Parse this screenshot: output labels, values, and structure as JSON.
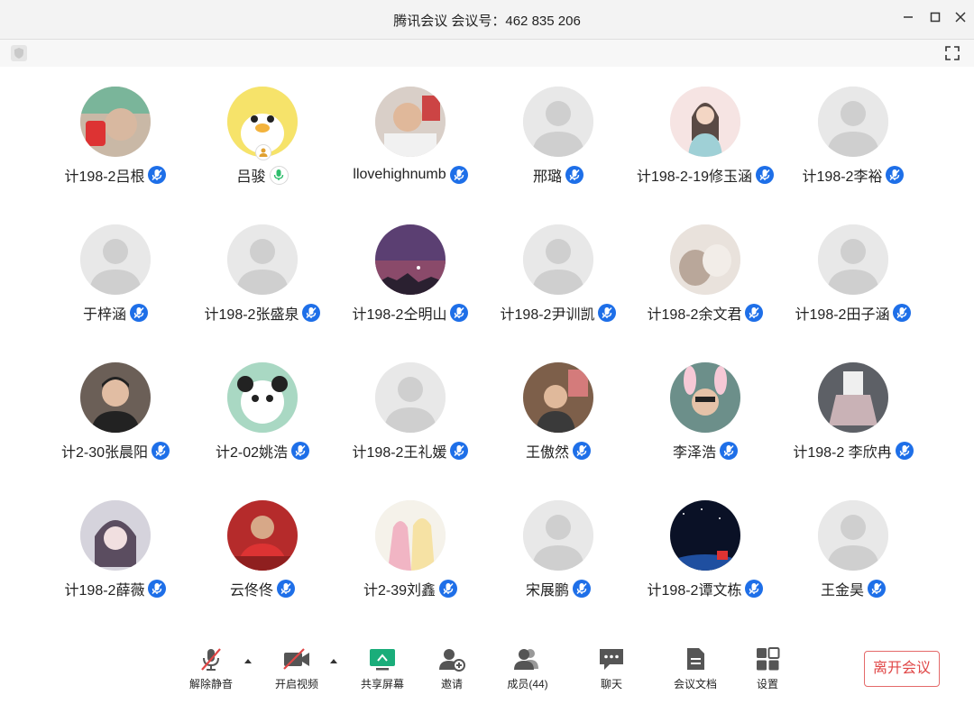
{
  "window": {
    "title": "腾讯会议 会议号：462 835 206"
  },
  "participants": [
    {
      "name": "计198-2吕根",
      "avatar": "photo-redshirt"
    },
    {
      "name": "吕骏",
      "avatar": "cartoon-duck",
      "speaking": true
    },
    {
      "name": "llovehighnumb",
      "avatar": "photo-meme"
    },
    {
      "name": "邢璐",
      "avatar": "default"
    },
    {
      "name": "计198-2-19修玉涵",
      "avatar": "illustration-girl"
    },
    {
      "name": "计198-2李裕",
      "avatar": "default"
    },
    {
      "name": "于梓涵",
      "avatar": "default"
    },
    {
      "name": "计198-2张盛泉",
      "avatar": "default"
    },
    {
      "name": "计198-2仝明山",
      "avatar": "night-sky"
    },
    {
      "name": "计198-2尹训凯",
      "avatar": "default"
    },
    {
      "name": "计198-2余文君",
      "avatar": "cats"
    },
    {
      "name": "计198-2田子涵",
      "avatar": "default"
    },
    {
      "name": "计2-30张晨阳",
      "avatar": "photo-man"
    },
    {
      "name": "计2-02姚浩",
      "avatar": "panda-meme"
    },
    {
      "name": "计198-2王礼媛",
      "avatar": "default"
    },
    {
      "name": "王傲然",
      "avatar": "photo-room"
    },
    {
      "name": "李泽浩",
      "avatar": "photo-bunny-ears"
    },
    {
      "name": "计198-2 李欣冉",
      "avatar": "photo-plaid-skirt"
    },
    {
      "name": "计198-2薛薇",
      "avatar": "anime-girl"
    },
    {
      "name": "云佟佟",
      "avatar": "photo-red-team"
    },
    {
      "name": "计2-39刘鑫",
      "avatar": "anime-couple"
    },
    {
      "name": "宋展鹏",
      "avatar": "default"
    },
    {
      "name": "计198-2谭文栋",
      "avatar": "earth-night"
    },
    {
      "name": "王金昊",
      "avatar": "default"
    }
  ],
  "toolbar": {
    "unmute": "解除静音",
    "start_video": "开启视频",
    "share_screen": "共享屏幕",
    "invite": "邀请",
    "members": "成员(44)",
    "chat": "聊天",
    "docs": "会议文档",
    "settings": "设置",
    "leave": "离开会议"
  },
  "colors": {
    "mic_blue": "#1e6fe8",
    "leave_red": "#e04747",
    "share_green": "#1aad7a"
  }
}
